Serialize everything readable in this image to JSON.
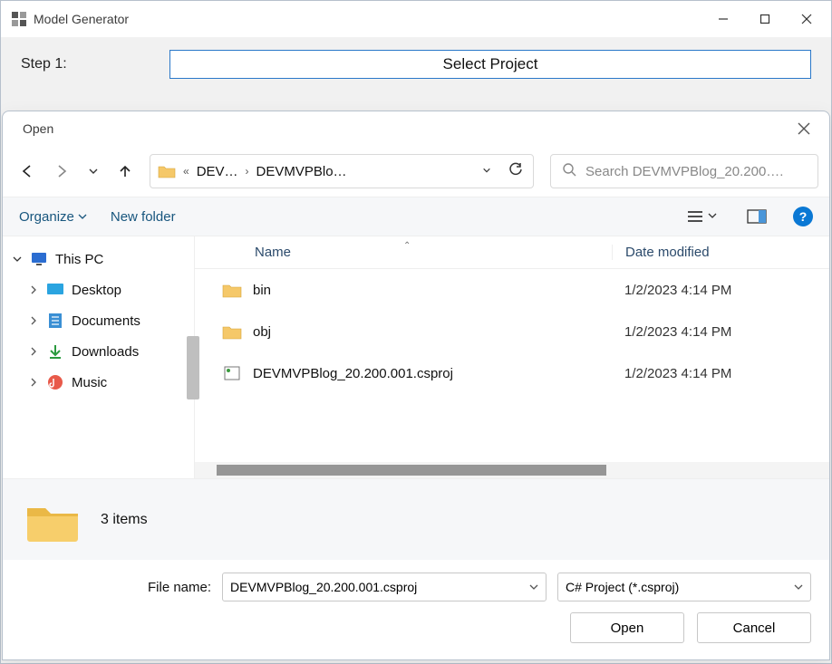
{
  "parent": {
    "title": "Model Generator",
    "step_label": "Step 1:",
    "select_project_label": "Select Project"
  },
  "dialog": {
    "title": "Open",
    "breadcrumb": {
      "seg1": "DEV…",
      "seg2": "DEVMVPBlo…"
    },
    "search_placeholder": "Search DEVMVPBlog_20.200….",
    "toolbar": {
      "organize": "Organize",
      "new_folder": "New folder"
    },
    "columns": {
      "name": "Name",
      "date": "Date modified"
    },
    "files": [
      {
        "name": "bin",
        "date": "1/2/2023 4:14 PM",
        "type": "folder"
      },
      {
        "name": "obj",
        "date": "1/2/2023 4:14 PM",
        "type": "folder"
      },
      {
        "name": "DEVMVPBlog_20.200.001.csproj",
        "date": "1/2/2023 4:14 PM",
        "type": "csproj"
      }
    ],
    "tree": {
      "root": "This PC",
      "items": [
        "Desktop",
        "Documents",
        "Downloads",
        "Music"
      ]
    },
    "status": "3 items",
    "filename_label": "File name:",
    "filename_value": "DEVMVPBlog_20.200.001.csproj",
    "filter_value": "C# Project (*.csproj)",
    "open_label": "Open",
    "cancel_label": "Cancel"
  }
}
